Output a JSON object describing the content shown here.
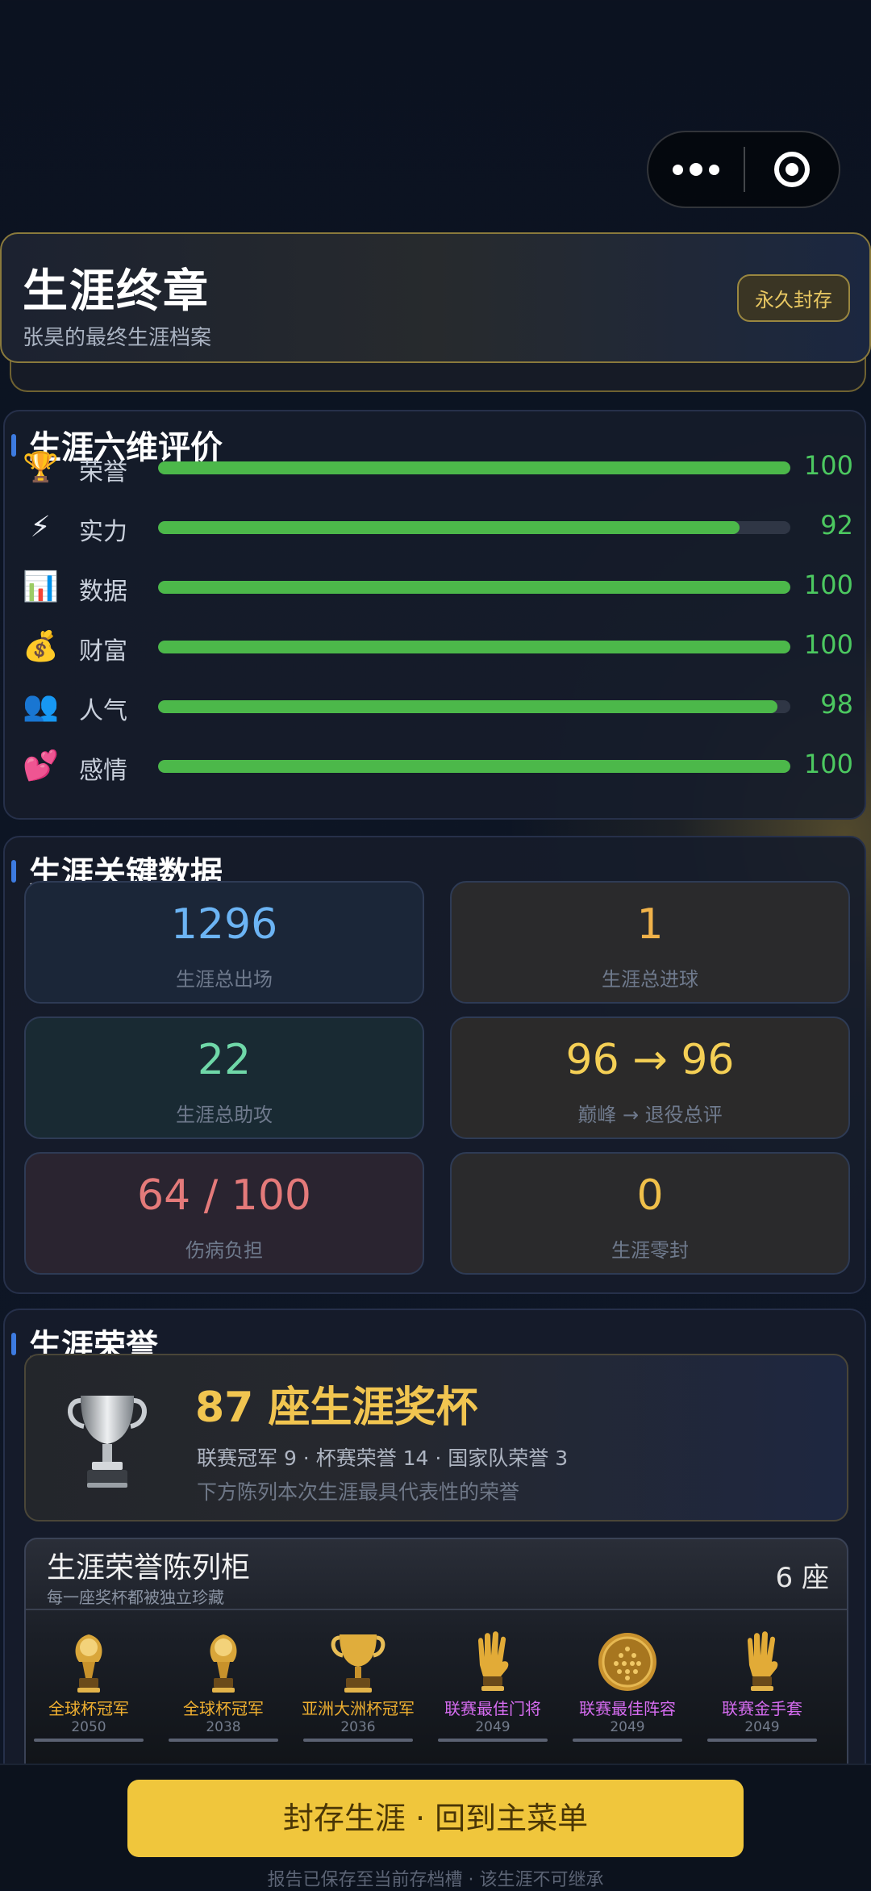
{
  "header": {
    "title": "生涯终章",
    "subtitle": "张昊的最终生涯档案",
    "badge": "永久封存"
  },
  "ratings": {
    "title": "生涯六维评价",
    "items": [
      {
        "icon": "trophy-icon",
        "glyph": "🏆",
        "label": "荣誉",
        "value": 100,
        "display": "100"
      },
      {
        "icon": "lightning-icon",
        "glyph": "⚡",
        "label": "实力",
        "value": 92,
        "display": "92"
      },
      {
        "icon": "bar-chart-icon",
        "glyph": "📊",
        "label": "数据",
        "value": 100,
        "display": "100"
      },
      {
        "icon": "money-bag-icon",
        "glyph": "💰",
        "label": "财富",
        "value": 100,
        "display": "100"
      },
      {
        "icon": "people-icon",
        "glyph": "👥",
        "label": "人气",
        "value": 98,
        "display": "98"
      },
      {
        "icon": "hearts-icon",
        "glyph": "💕",
        "label": "感情",
        "value": 100,
        "display": "100"
      }
    ]
  },
  "key_stats": {
    "title": "生涯关键数据",
    "items": [
      {
        "value": "1296",
        "label": "生涯总出场",
        "color": "#6cb4f4"
      },
      {
        "value": "1",
        "label": "生涯总进球",
        "color": "#f0b24a"
      },
      {
        "value": "22",
        "label": "生涯总助攻",
        "color": "#6fd7a8"
      },
      {
        "value": "96 → 96",
        "label": "巅峰 → 退役总评",
        "color": "#f4cf55"
      },
      {
        "value": "64 / 100",
        "label": "伤病负担",
        "color": "#e47a7a"
      },
      {
        "value": "0",
        "label": "生涯零封",
        "color": "#f0c04a"
      }
    ]
  },
  "honors": {
    "title": "生涯荣誉",
    "trophy_total": "87 座生涯奖杯",
    "breakdown": "联赛冠军 9 · 杯赛荣誉 14 · 国家队荣誉 3",
    "note": "下方陈列本次生涯最具代表性的荣誉",
    "cabinet": {
      "title": "生涯荣誉陈列柜",
      "subtitle": "每一座奖杯都被独立珍藏",
      "count": "6 座",
      "items": [
        {
          "icon": "world-cup-trophy-icon",
          "name": "全球杯冠军",
          "year": "2050",
          "color": "#f0b030"
        },
        {
          "icon": "world-cup-trophy-icon",
          "name": "全球杯冠军",
          "year": "2038",
          "color": "#f0b030"
        },
        {
          "icon": "continental-cup-icon",
          "name": "亚洲大洲杯冠军",
          "year": "2036",
          "color": "#f0b030"
        },
        {
          "icon": "golden-glove-icon",
          "name": "联赛最佳门将",
          "year": "2049",
          "color": "#d66cf0"
        },
        {
          "icon": "medal-icon",
          "name": "联赛最佳阵容",
          "year": "2049",
          "color": "#d66cf0"
        },
        {
          "icon": "golden-glove-icon",
          "name": "联赛金手套",
          "year": "2049",
          "color": "#d66cf0"
        }
      ]
    }
  },
  "footer": {
    "cta": "封存生涯 · 回到主菜单",
    "note": "报告已保存至当前存档槽 · 该生涯不可继承"
  },
  "colors": {
    "accent_gold": "#f0c63c",
    "bar_green": "#4cb84a",
    "section_marker": "#3d7be0"
  }
}
